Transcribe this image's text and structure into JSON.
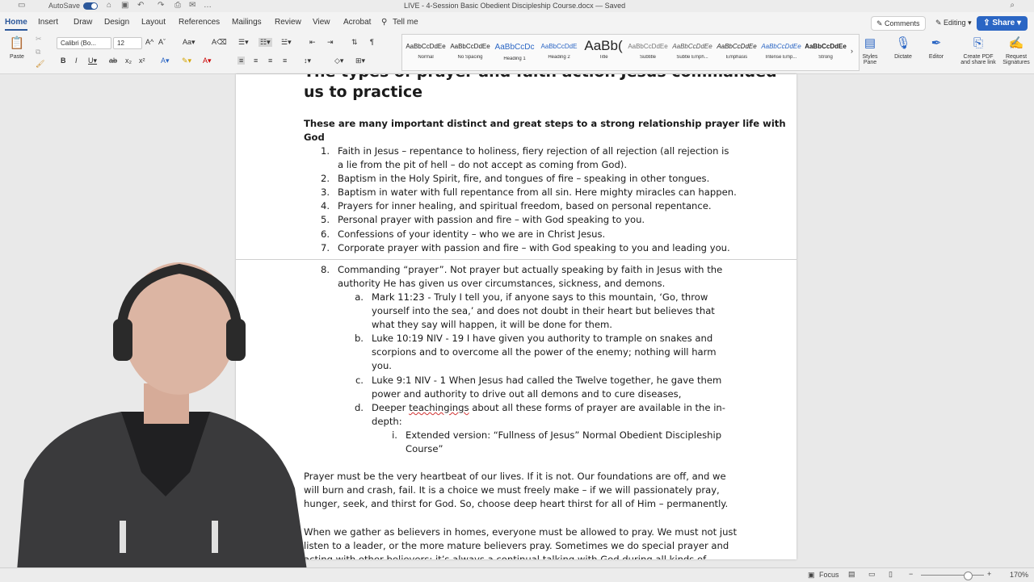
{
  "titlebar": {
    "autosave": "AutoSave",
    "doc_title": "LIVE - 4-Session Basic Obedient Discipleship Course.docx — Saved"
  },
  "tabs": [
    "Home",
    "Insert",
    "Draw",
    "Design",
    "Layout",
    "References",
    "Mailings",
    "Review",
    "View",
    "Acrobat",
    "Tell me"
  ],
  "top_right": {
    "comments": "Comments",
    "editing": "Editing",
    "share": "Share"
  },
  "ribbon": {
    "paste": "Paste",
    "font_name": "Calibri (Bo...",
    "font_size": "12",
    "styles": [
      {
        "sample": "AaBbCcDdEe",
        "name": "Normal"
      },
      {
        "sample": "AaBbCcDdEe",
        "name": "No Spacing"
      },
      {
        "sample": "AaBbCcDc",
        "name": "Heading 1"
      },
      {
        "sample": "AaBbCcDdE",
        "name": "Heading 2"
      },
      {
        "sample": "AaBb(",
        "name": "Title"
      },
      {
        "sample": "AaBbCcDdEe",
        "name": "Subtitle"
      },
      {
        "sample": "AaBbCcDdEe",
        "name": "Subtle Emph..."
      },
      {
        "sample": "AaBbCcDdEe",
        "name": "Emphasis"
      },
      {
        "sample": "AaBbCcDdEe",
        "name": "Intense Emp..."
      },
      {
        "sample": "AaBbCcDdEe",
        "name": "Strong"
      }
    ],
    "styles_pane": "Styles Pane",
    "dictate": "Dictate",
    "editor": "Editor",
    "create_pdf": "Create PDF and share link",
    "request_signatures": "Request Signatures"
  },
  "document": {
    "heading_line1": "The types of prayer and faith action Jesus commanded",
    "heading_line2": "us to practice",
    "intro_line1": "These are many important distinct and great steps to a strong relationship prayer life with",
    "intro_line2": "God",
    "list": [
      {
        "n": "1.",
        "lines": [
          "Faith in Jesus – repentance to holiness, fiery rejection of all rejection (all rejection is",
          "a lie from the pit of hell – do not accept as coming from God)."
        ]
      },
      {
        "n": "2.",
        "lines": [
          "Baptism in the Holy Spirit, fire, and tongues of fire – speaking in other tongues."
        ]
      },
      {
        "n": "3.",
        "lines": [
          "Baptism in water with full repentance from all sin. Here mighty miracles can happen."
        ]
      },
      {
        "n": "4.",
        "lines": [
          "Prayers for inner healing, and spiritual freedom, based on personal repentance."
        ]
      },
      {
        "n": "5.",
        "lines": [
          "Personal prayer with passion and fire – with God speaking to you."
        ]
      },
      {
        "n": "6.",
        "lines": [
          "Confessions of your identity – who we are in Christ Jesus."
        ]
      },
      {
        "n": "7.",
        "lines": [
          "Corporate prayer with passion and fire – with God speaking to you and leading you."
        ]
      },
      {
        "n": "8.",
        "lines": [
          "Commanding “prayer”. Not prayer but actually speaking by faith in Jesus with the",
          "authority He has given us over circumstances, sickness, and demons."
        ]
      }
    ],
    "sublist": [
      {
        "n": "a.",
        "lines": [
          "Mark 11:23 - Truly I tell you, if anyone says to this mountain, ‘Go, throw",
          "yourself into the sea,’ and does not doubt in their heart but believes that",
          "what they say will happen, it will be done for them."
        ]
      },
      {
        "n": "b.",
        "lines": [
          "Luke 10:19 NIV - 19 I have given you authority to trample on snakes and",
          "scorpions and to overcome all the power of the enemy; nothing will harm",
          "you."
        ]
      },
      {
        "n": "c.",
        "lines": [
          "Luke 9:1 NIV - 1 When Jesus had called the Twelve together, he gave them",
          "power and authority to drive out all demons and to cure diseases,"
        ]
      },
      {
        "n": "d.",
        "line1_pre": "Deeper ",
        "line1_err": "teachingings",
        "line1_post": " about all these forms of prayer are available in the in-",
        "line2": "depth:"
      }
    ],
    "subsub": {
      "n": "i.",
      "lines": [
        "Extended version: “Fullness of Jesus” Normal Obedient Discipleship",
        "Course”"
      ]
    },
    "para1": [
      "Prayer must be the very heartbeat of our lives. If it is not. Our foundations are off, and we",
      "will burn and crash, fail. It is a choice we must freely make – if we will passionately pray,",
      "hunger, seek, and thirst for God. So, choose deep heart thirst for all of Him – permanently."
    ],
    "para2": [
      "When we gather as believers in homes, everyone must be allowed to pray. We must not just",
      "listen to a leader, or the more mature believers pray. Sometimes we do special prayer and",
      "acting with other believers: it’s always a continual talking with God during all kinds of"
    ]
  },
  "statusbar": {
    "focus": "Focus",
    "zoom": "170%"
  }
}
